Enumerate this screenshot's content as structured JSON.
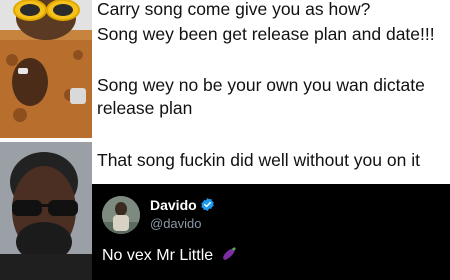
{
  "tweet_top": {
    "lines": [
      "Carry song come give you as how?",
      "Song wey been get release plan and date!!!",
      "Song wey no be your own you wan dictate",
      "release plan",
      "That song fuckin did well without you on it"
    ]
  },
  "reply_tweet": {
    "display_name": "Davido",
    "handle": "@davido",
    "text": "No vex Mr Little",
    "emoji_icon": "eggplant-icon",
    "verified_icon": "verified-badge-icon"
  },
  "colors": {
    "dark_card_bg": "#000000",
    "verified_blue": "#1d9bf0",
    "handle_gray": "#8b98a5"
  }
}
